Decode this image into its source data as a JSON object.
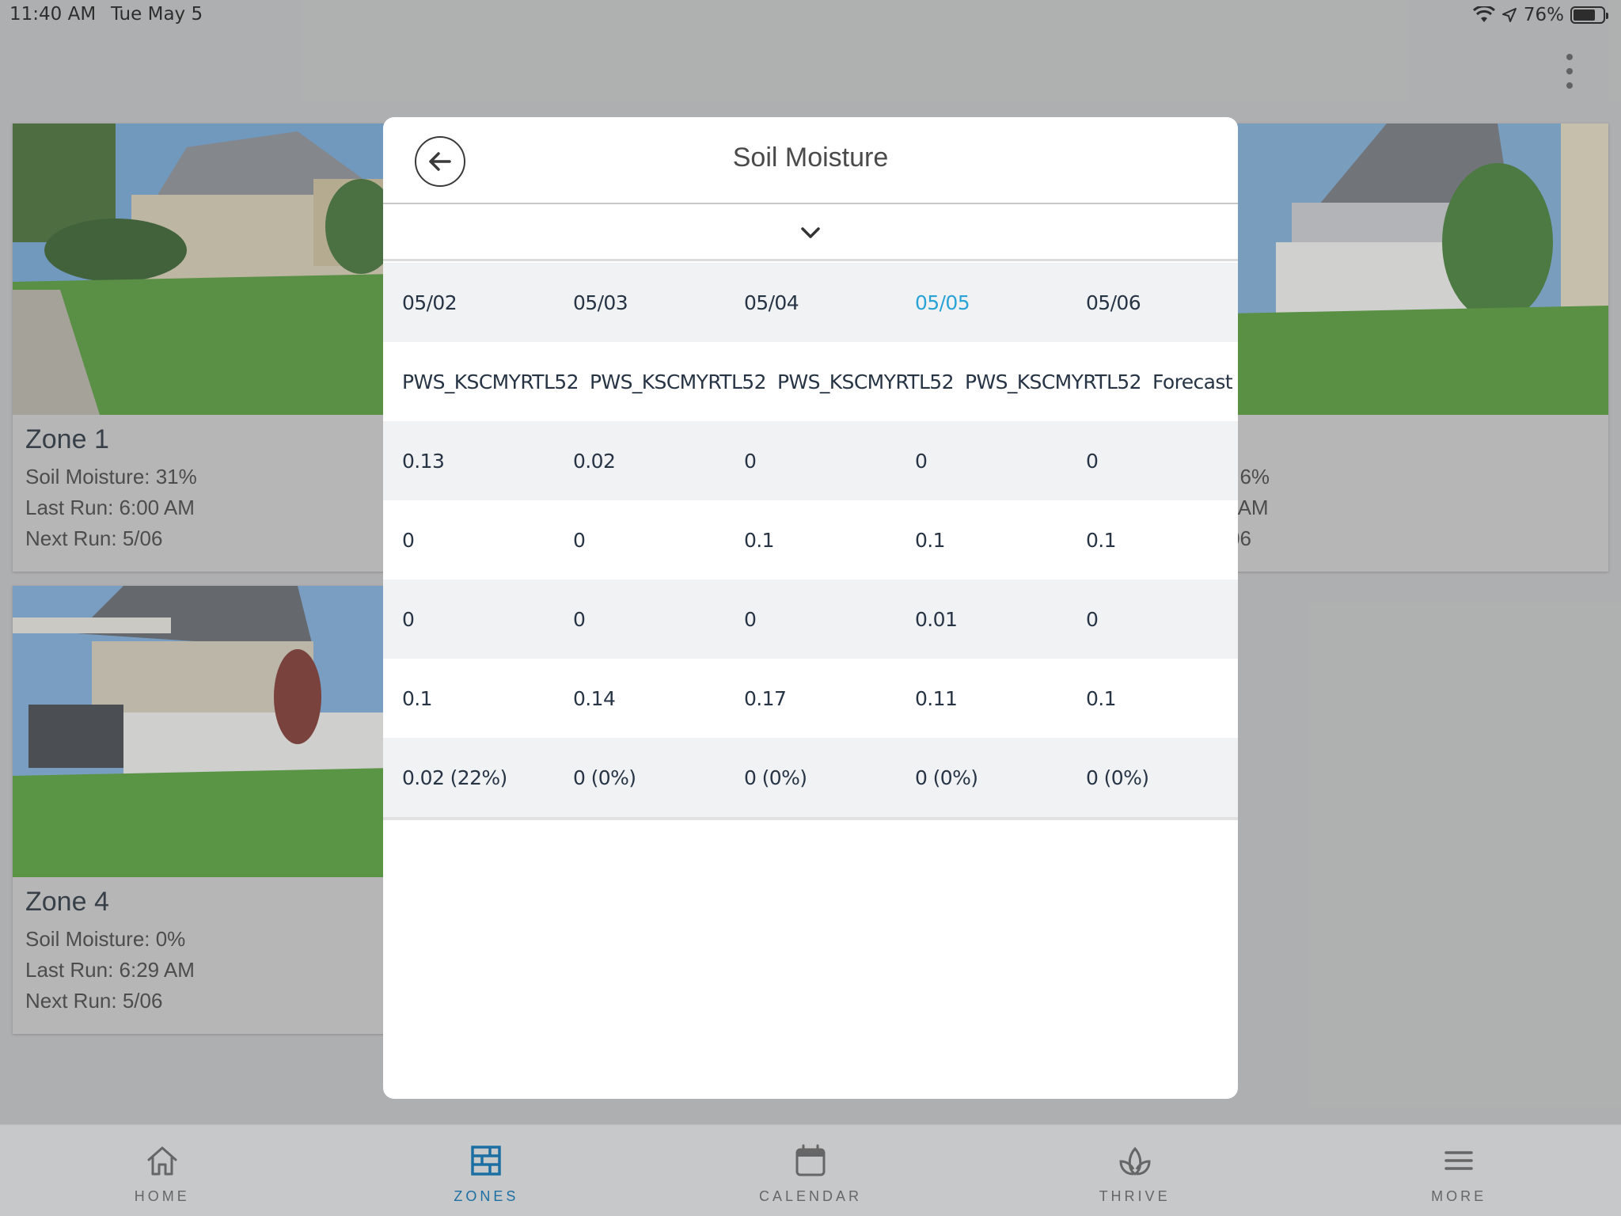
{
  "status_bar": {
    "time": "11:40 AM",
    "date": "Tue May 5",
    "battery": "76%",
    "battery_level": 0.76
  },
  "zones": [
    {
      "title": "Zone 1",
      "soil_moisture": "Soil Moisture: 31%",
      "last_run": "Last Run: 6:00 AM",
      "next_run": "Next Run: 5/06"
    },
    {
      "title": "Zone 4",
      "soil_moisture": "Soil Moisture: 0%",
      "last_run": "Last Run: 6:29 AM",
      "next_run": "Next Run: 5/06"
    },
    {
      "partial_line_1": ": 6%",
      "partial_line_2": "l AM",
      "partial_line_3": "06"
    }
  ],
  "modal": {
    "title": "Soil Moisture",
    "back_icon": "arrow-left-icon",
    "collapse_icon": "chevron-down-icon",
    "highlight_color": "#2aa3d6",
    "rows": [
      [
        "05/02",
        "05/03",
        "05/04",
        "05/05",
        "05/06"
      ],
      [
        "PWS_KSCMYRTL52",
        "PWS_KSCMYRTL52",
        "PWS_KSCMYRTL52",
        "PWS_KSCMYRTL52",
        "Forecast"
      ],
      [
        "0.13",
        "0.02",
        "0",
        "0",
        "0"
      ],
      [
        "0",
        "0",
        "0.1",
        "0.1",
        "0.1"
      ],
      [
        "0",
        "0",
        "0",
        "0.01",
        "0"
      ],
      [
        "0.1",
        "0.14",
        "0.17",
        "0.11",
        "0.1"
      ],
      [
        "0.02 (22%)",
        "0 (0%)",
        "0 (0%)",
        "0 (0%)",
        "0 (0%)"
      ]
    ]
  },
  "tabs": [
    {
      "label": "HOME",
      "icon": "home-icon",
      "active": false
    },
    {
      "label": "ZONES",
      "icon": "zones-icon",
      "active": true
    },
    {
      "label": "CALENDAR",
      "icon": "calendar-icon",
      "active": false
    },
    {
      "label": "THRIVE",
      "icon": "plant-icon",
      "active": false
    },
    {
      "label": "MORE",
      "icon": "menu-icon",
      "active": false
    }
  ],
  "colors": {
    "accent": "#1c6fa3",
    "table_shade": "#f1f2f3",
    "text_dark": "#263445"
  }
}
